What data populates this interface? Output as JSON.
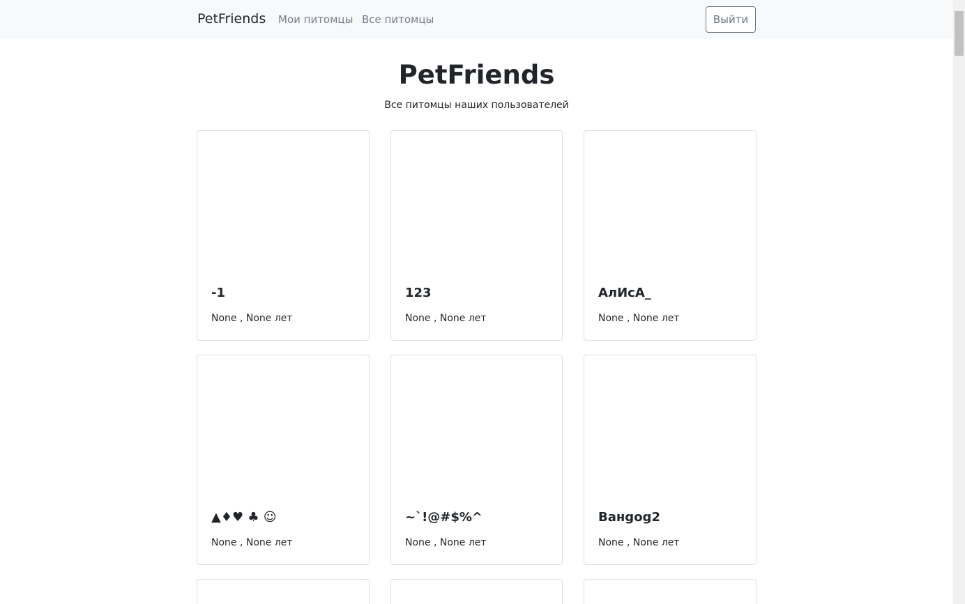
{
  "navbar": {
    "brand": "PetFriends",
    "links": [
      "Мои питомцы",
      "Все питомцы"
    ],
    "logout": "Выйти"
  },
  "header": {
    "title": "PetFriends",
    "subtitle": "Все питомцы наших пользователей"
  },
  "pets": [
    {
      "name": "-1",
      "info": "None , None лет"
    },
    {
      "name": "123",
      "info": "None , None лет"
    },
    {
      "name": "АлИсА_",
      "info": "None , None лет"
    },
    {
      "name": "▲♦♥ ♣ ☺",
      "info": "None , None лет"
    },
    {
      "name": "~`!@#$%^",
      "info": "None , None лет"
    },
    {
      "name": "Ванgog2",
      "info": "None , None лет"
    },
    {
      "name": "",
      "info": ""
    },
    {
      "name": "",
      "info": ""
    },
    {
      "name": "",
      "info": ""
    }
  ]
}
